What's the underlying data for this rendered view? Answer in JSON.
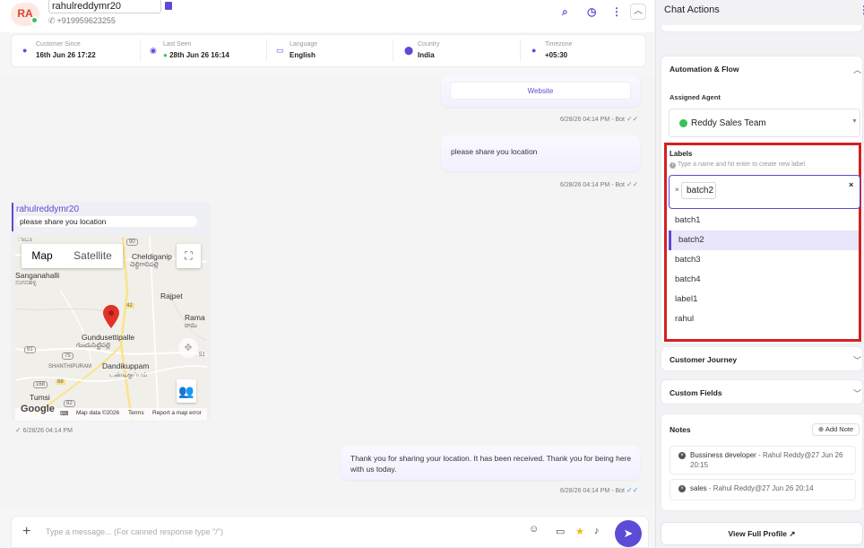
{
  "contact": {
    "initials": "RA",
    "name": "rahulreddymr20",
    "phone": "+919959623255"
  },
  "info": [
    {
      "label": "Customer Since",
      "value": "16th Jun 26 17:22",
      "icon": "user-icon"
    },
    {
      "label": "Last Seen",
      "value": "28th Jun 26 16:14",
      "icon": "eye-icon"
    },
    {
      "label": "Language",
      "value": "English",
      "icon": "language-icon"
    },
    {
      "label": "Country",
      "value": "India",
      "icon": "location-pin-icon"
    },
    {
      "label": "Timezone",
      "value": "+05:30",
      "icon": "clock-icon"
    }
  ],
  "messages": {
    "website_button": "Website",
    "meta1": "6/28/26 04:14 PM - Bot",
    "bot_share_location": "please share you location",
    "meta2": "6/28/26 04:14 PM - Bot",
    "incoming_name": "rahulreddymr20",
    "incoming_quote": "please share you location",
    "incoming_meta": "6/28/26 04:14 PM",
    "bot_thanks": "Thank you for sharing your location. It has been received. Thank you for being here with us today.",
    "meta3": "6/28/26 04:14 PM - Bot"
  },
  "map": {
    "type_map": "Map",
    "type_satellite": "Satellite",
    "places": {
      "sanganahalli": "Sanganahalli",
      "sanganahalli_kn": "ಸಂಗನಹಳ್ಳಿ",
      "cheldiganip": "Cheldiganip",
      "cheldiganip_te": "చెల్దిగానిపల్లె",
      "rajpet": "Rajpet",
      "rama": "Rama",
      "rama_te": "రామ",
      "gundusettipalle": "Gundusettipalle",
      "gundusettipalle_te": "గుండుసెట్టిపల్లె",
      "shanthipuram": "SHANTHIPURAM",
      "dandikuppam": "Dandikuppam",
      "dandikuppam_ta": "டண்டிகுப்பம்",
      "tumsi": "Tumsi",
      "top_left": "ಾಬೂ"
    },
    "roads": {
      "r90": "90",
      "r42": "42",
      "r81": "81",
      "r75": "75",
      "r68": "68",
      "r168": "168",
      "r82": "82",
      "r51": "51"
    },
    "google": "Google",
    "map_data": "Map data ©2026",
    "terms": "Terms",
    "report": "Report a map error"
  },
  "composer": {
    "placeholder": "Type a message... (For canned response type \"/\")"
  },
  "panel": {
    "title": "Chat Actions",
    "automation_title": "Automation & Flow",
    "assigned_agent_label": "Assigned Agent",
    "assigned_agent": "Reddy Sales Team",
    "labels_title": "Labels",
    "labels_hint": "Type a name and hit enter to create new label",
    "selected_chip": "batch2",
    "options": [
      "batch1",
      "batch2",
      "batch3",
      "batch4",
      "label1",
      "rahul"
    ],
    "customer_journey": "Customer Journey",
    "custom_fields": "Custom Fields",
    "notes_title": "Notes",
    "add_note": "Add Note",
    "notes": [
      {
        "text": "Bussiness developer",
        "author": " - Rahul Reddy@27 Jun 26 20:15"
      },
      {
        "text": "sales",
        "author": " - Rahul Reddy@27 Jun 26 20:14"
      }
    ],
    "view_full_profile": "View Full Profile"
  },
  "colors": {
    "accent": "#5b4bd6",
    "highlight_border": "#d42020",
    "online": "#3cbf5a"
  }
}
